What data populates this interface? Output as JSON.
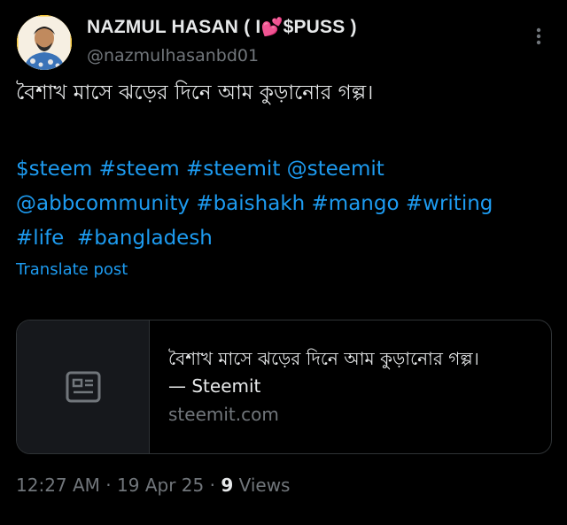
{
  "author": {
    "display_name": "NAZMUL HASAN ( I ",
    "display_name_suffix": "$PUSS )",
    "emoji": "💕",
    "handle": "@nazmulhasanbd01"
  },
  "post": {
    "text": "বৈশাখ মাসে ঝড়ের দিনে আম কুড়ানোর গল্প।",
    "tags_lines": [
      [
        "$steem",
        "#steem",
        "#steemit",
        "@steemit"
      ],
      [
        "@abbcommunity",
        "#baishakh",
        "#mango",
        "#writing"
      ],
      [
        "#life",
        " #bangladesh"
      ]
    ],
    "translate_label": "Translate post"
  },
  "link_card": {
    "title": "বৈশাখ মাসে ঝড়ের দিনে আম কুড়ানোর গল্প।",
    "source": "— Steemit",
    "domain": "steemit.com",
    "thumb_icon": "article-icon"
  },
  "meta": {
    "time": "12:27 AM",
    "separator": " · ",
    "date": "19 Apr 25",
    "views_count": "9",
    "views_label": " Views"
  },
  "icons": {
    "more": "more-vertical-icon"
  },
  "colors": {
    "background": "#000000",
    "text": "#e7e9ea",
    "muted": "#71767b",
    "link": "#1d9bf0",
    "border": "#2f3336"
  }
}
